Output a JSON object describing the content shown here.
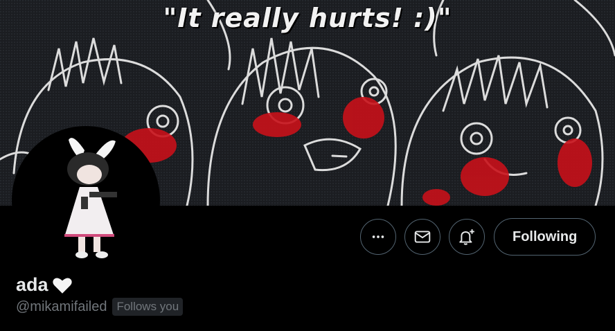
{
  "banner": {
    "text": "\"It really hurts! :)\""
  },
  "profile": {
    "name": "ada",
    "name_emoji": "white-heart-icon",
    "handle": "@mikamifailed",
    "follows_you_label": "Follows you"
  },
  "actions": {
    "more_icon": "more-icon",
    "message_icon": "mail-icon",
    "notify_icon": "bell-plus-icon",
    "following_label": "Following"
  },
  "colors": {
    "background": "#000000",
    "border": "#536471",
    "text_primary": "#e7e9ea",
    "text_secondary": "#71767b",
    "banner_accent": "#c8111a"
  }
}
